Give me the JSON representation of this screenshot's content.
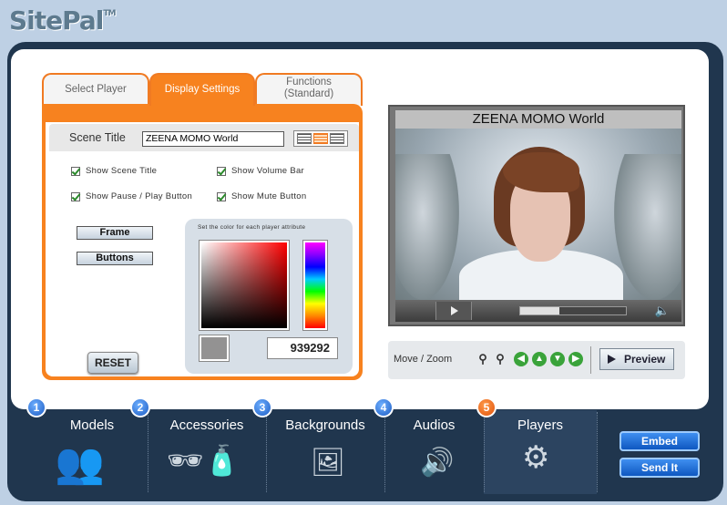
{
  "app": {
    "logo": "SitePal",
    "tm": "TM"
  },
  "tabs": [
    {
      "label": "Select Player"
    },
    {
      "label": "Display Settings"
    },
    {
      "label": "Functions\n(Standard)"
    }
  ],
  "settings": {
    "scene_title_label": "Scene Title",
    "scene_title_value": "ZEENA MOMO World",
    "checkboxes": [
      {
        "label": "Show Scene Title",
        "checked": true
      },
      {
        "label": "Show Volume Bar",
        "checked": true
      },
      {
        "label": "Show Pause / Play Button",
        "checked": true
      },
      {
        "label": "Show Mute Button",
        "checked": true
      }
    ],
    "frame_label": "Frame",
    "buttons_label": "Buttons",
    "reset_label": "RESET",
    "color_caption": "Set the color for each player attribute",
    "hex_value": "939292",
    "swatch_color": "#939292"
  },
  "preview": {
    "scene_title": "ZEENA MOMO World",
    "progress": 0.37
  },
  "move_zoom": {
    "label": "Move / Zoom",
    "preview_label": "Preview"
  },
  "nav": [
    {
      "num": "1",
      "label": "Models"
    },
    {
      "num": "2",
      "label": "Accessories"
    },
    {
      "num": "3",
      "label": "Backgrounds"
    },
    {
      "num": "4",
      "label": "Audios"
    },
    {
      "num": "5",
      "label": "Players"
    }
  ],
  "side_buttons": {
    "embed": "Embed",
    "send": "Send It"
  },
  "colors": {
    "accent": "#f7821f",
    "nav_bg": "#20364e",
    "button_blue": "#1f6fdb"
  }
}
